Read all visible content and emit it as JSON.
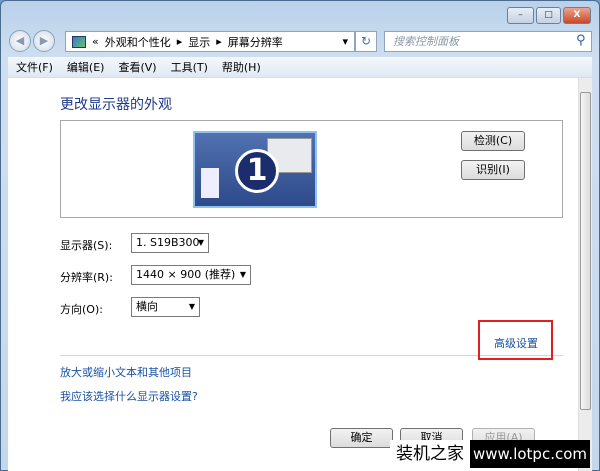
{
  "window": {
    "minimize": "–",
    "maximize": "□",
    "close": "X"
  },
  "nav": {
    "back": "◀",
    "forward": "▶",
    "breadcrumb_prefix": "«",
    "breadcrumb": [
      "外观和个性化",
      "显示",
      "屏幕分辨率"
    ],
    "separator": "▸",
    "dropdown": "▾",
    "refresh": "↻",
    "search_placeholder": "搜索控制面板",
    "search_icon": "⚲"
  },
  "menu": [
    "文件(F)",
    "编辑(E)",
    "查看(V)",
    "工具(T)",
    "帮助(H)"
  ],
  "main": {
    "title": "更改显示器的外观",
    "monitor_number": "1",
    "detect": "检测(C)",
    "identify": "识别(I)",
    "display_label": "显示器(S):",
    "display_value": "1. S19B300",
    "resolution_label": "分辨率(R):",
    "resolution_value": "1440 × 900 (推荐)",
    "orientation_label": "方向(O):",
    "orientation_value": "横向",
    "advanced": "高级设置",
    "link1": "放大或缩小文本和其他项目",
    "link2": "我应该选择什么显示器设置?",
    "ok": "确定",
    "cancel": "取消",
    "apply": "应用(A)"
  },
  "watermark": {
    "cn": "装机之家",
    "url": "www.lotpc.com"
  },
  "colors": {
    "title": "#1e3a8a",
    "link": "#1a52a5",
    "highlight": "#e02020"
  }
}
